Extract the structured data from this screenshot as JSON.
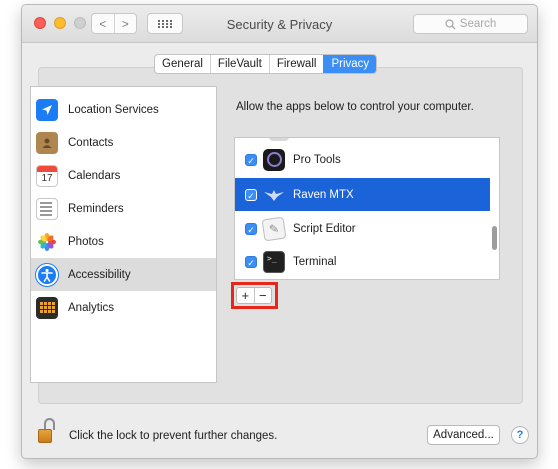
{
  "window": {
    "title": "Security & Privacy",
    "search_placeholder": "Search"
  },
  "toolbar": {
    "back_glyph": "<",
    "forward_glyph": ">"
  },
  "tabs": [
    {
      "label": "General",
      "active": false
    },
    {
      "label": "FileVault",
      "active": false
    },
    {
      "label": "Firewall",
      "active": false
    },
    {
      "label": "Privacy",
      "active": true
    }
  ],
  "sidebar": {
    "items": [
      {
        "label": "Location Services",
        "icon": "location-arrow-icon",
        "selected": false
      },
      {
        "label": "Contacts",
        "icon": "contacts-book-icon",
        "selected": false
      },
      {
        "label": "Calendars",
        "icon": "calendar-icon",
        "icon_text": "17",
        "selected": false
      },
      {
        "label": "Reminders",
        "icon": "reminders-list-icon",
        "selected": false
      },
      {
        "label": "Photos",
        "icon": "photos-flower-icon",
        "selected": false
      },
      {
        "label": "Accessibility",
        "icon": "accessibility-icon",
        "selected": true
      },
      {
        "label": "Analytics",
        "icon": "analytics-icon",
        "selected": false
      }
    ]
  },
  "main": {
    "description": "Allow the apps below to control your computer.",
    "apps": [
      {
        "name": "Pro Tools",
        "checked": true,
        "selected": false,
        "icon": "pro-tools-icon"
      },
      {
        "name": "Raven MTX",
        "checked": true,
        "selected": true,
        "icon": "raven-bird-icon"
      },
      {
        "name": "Script Editor",
        "checked": true,
        "selected": false,
        "icon": "script-editor-icon"
      },
      {
        "name": "Terminal",
        "checked": true,
        "selected": false,
        "icon": "terminal-icon"
      }
    ],
    "add_label": "+",
    "remove_label": "−"
  },
  "footer": {
    "lock_text": "Click the lock to prevent further changes.",
    "advanced_label": "Advanced...",
    "help_label": "?"
  },
  "colors": {
    "accent": "#3a8ef5",
    "selection": "#1b63d9",
    "highlight_box": "#e8271c"
  }
}
